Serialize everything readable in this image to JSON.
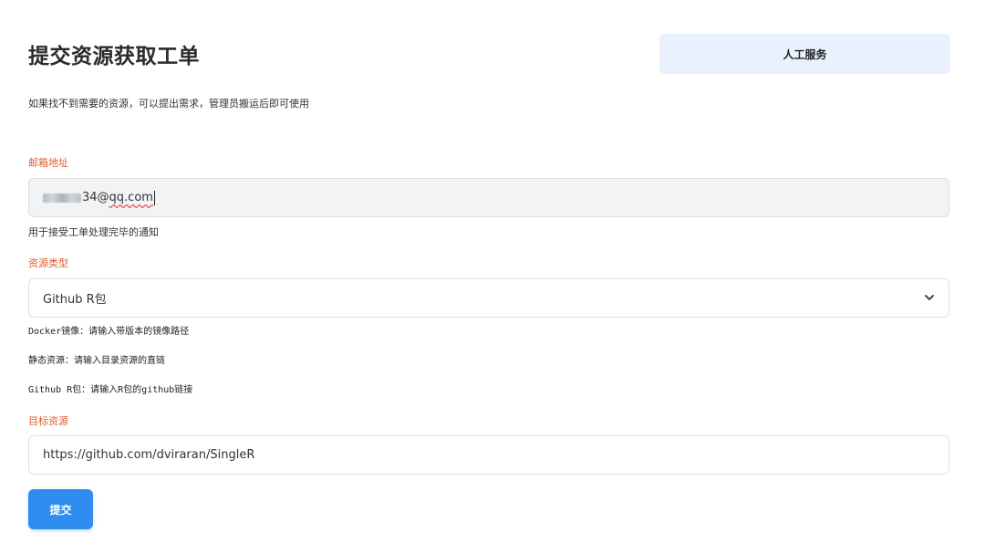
{
  "header": {
    "title": "提交资源获取工单",
    "service_button_label": "人工服务"
  },
  "intro": "如果找不到需要的资源，可以提出需求，管理员搬运后即可使用",
  "email": {
    "label": "邮箱地址",
    "value_visible": "34@",
    "value_domain": "qq.com",
    "help": "用于接受工单处理完毕的通知"
  },
  "resource_type": {
    "label": "资源类型",
    "selected": "Github R包",
    "notes": [
      "Docker镜像：请输入带版本的镜像路径",
      "静态资源：请输入目录资源的直链",
      "Github R包：请输入R包的github链接"
    ]
  },
  "target": {
    "label": "目标资源",
    "value": "https://github.com/dviraran/SingleR"
  },
  "submit_label": "提交",
  "colors": {
    "label_accent": "#e05a2b",
    "primary": "#2f8cf0",
    "service_bg": "#e8f1fd",
    "email_bg": "#f1f3f5"
  },
  "icons": {
    "select_arrow": "chevron-down-icon"
  }
}
